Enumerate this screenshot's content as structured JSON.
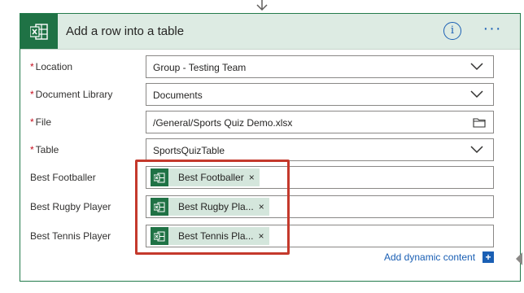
{
  "action": {
    "title": "Add a row into a table",
    "info_icon": "info-icon",
    "more_icon": "more-options-icon",
    "app_icon": "excel-icon",
    "more_label": "···",
    "info_label": "i"
  },
  "required_marker": "*",
  "fields": {
    "location": {
      "label": "Location",
      "value": "Group - Testing Team",
      "required": true
    },
    "library": {
      "label": "Document Library",
      "value": "Documents",
      "required": true
    },
    "file": {
      "label": "File",
      "value": "/General/Sports Quiz Demo.xlsx",
      "required": true
    },
    "table": {
      "label": "Table",
      "value": "SportsQuizTable",
      "required": true
    }
  },
  "columns": {
    "footballer": {
      "label": "Best Footballer",
      "token": "Best Footballer"
    },
    "rugby": {
      "label": "Best Rugby Player",
      "token": "Best Rugby Pla..."
    },
    "tennis": {
      "label": "Best Tennis Player",
      "token": "Best Tennis Pla..."
    }
  },
  "token_remove": "×",
  "dynamic_content": {
    "label": "Add dynamic content",
    "plus": "+"
  },
  "colors": {
    "header_bg": "#DDEBE3",
    "excel_green": "#1F7245",
    "token_bg": "#D4E6DC",
    "highlight": "#C4392C",
    "link_blue": "#1a5fb4"
  }
}
